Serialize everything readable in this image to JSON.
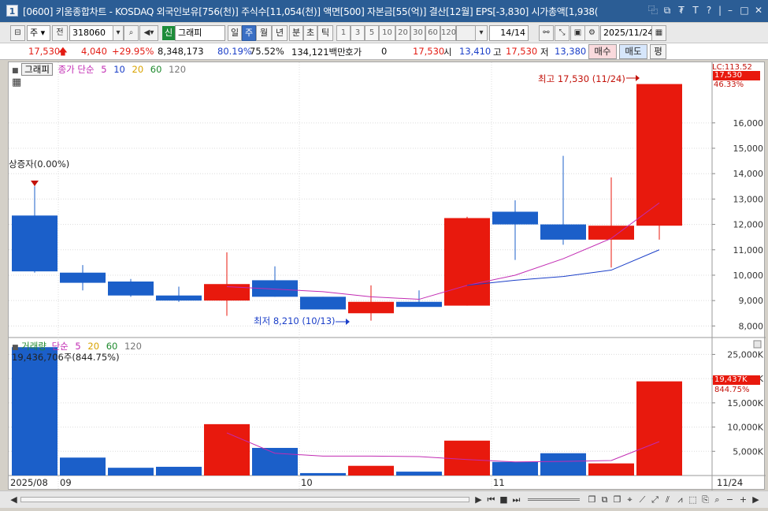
{
  "titlebar": {
    "number": "1",
    "text": "[0600] 키움종합차트 - KOSDAQ 외국인보유[756(천)] 주식수[11,054(천)] 액면[500] 자본금[55(억)] 결산[12월] EPS[-3,830] 시가총액[1,938(",
    "buttons": [
      "⿻",
      "⧉",
      "₮",
      "T",
      "?",
      "|",
      "–",
      "□",
      "✕"
    ]
  },
  "toolbar": {
    "market": "주",
    "prev": "전",
    "code": "318060",
    "sin_badge": "신",
    "stock_name": "그래피",
    "periods": [
      "일",
      "주",
      "월",
      "년",
      "분",
      "초",
      "틱"
    ],
    "active_period": "주",
    "intervals": [
      "1",
      "3",
      "5",
      "10",
      "20",
      "30",
      "60",
      "120"
    ],
    "count": "14/14",
    "date": "2025/11/24"
  },
  "quote": {
    "price": "17,530",
    "arrow": "🡅",
    "change": "4,040",
    "change_pct": "+29.95%",
    "volume": "8,348,173",
    "vol_pct": "80.19%",
    "turnover": "75.52%",
    "amount": "134,121백만",
    "hoga_label": "호가",
    "hoga_value": "0",
    "current": "17,530",
    "open_label": "시",
    "open": "13,410",
    "high_label": "고",
    "high": "17,530",
    "low_label": "저",
    "low": "13,380",
    "buy_button": "매수",
    "sell_button": "매도",
    "eval_button": "평"
  },
  "price_legend": {
    "name": "그래피",
    "label": "종가 단순",
    "periods": [
      "5",
      "10",
      "20",
      "60",
      "120"
    ],
    "colors": [
      "#c22bb3",
      "#1a3ec8",
      "#d9a300",
      "#1f8a2e",
      "#777777"
    ]
  },
  "volume_legend": {
    "name": "거래량",
    "label": "단순",
    "periods": [
      "5",
      "20",
      "60",
      "120"
    ],
    "colors": [
      "#c22bb3",
      "#d9a300",
      "#1f8a2e",
      "#777777"
    ],
    "current_text": "19,436,706주(844.75%)"
  },
  "annotations": {
    "ipo": "상증자(0.00%)",
    "high": "최고 17,530 (11/24)",
    "low": "최저 8,210 (10/13)"
  },
  "price_axis": {
    "ticks": [
      "16,000",
      "15,000",
      "14,000",
      "13,000",
      "12,000",
      "11,000",
      "10,000",
      "9,000",
      "8,000"
    ],
    "tag_top": "LC:113.52",
    "tag_price": "17,530",
    "tag_pct": "46.33%"
  },
  "volume_axis": {
    "ticks": [
      "25,000K",
      "20,000K",
      "15,000K",
      "10,000K",
      "5,000K"
    ],
    "tag_value": "19,437K",
    "tag_pct": "844.75%"
  },
  "x_axis": {
    "labels": [
      "2025/08",
      "09",
      "10",
      "11"
    ],
    "end_label": "11/24"
  },
  "colors": {
    "up": "#e8190d",
    "down": "#1b5fc9",
    "ma5": "#c22bb3",
    "ma10": "#1a3ec8"
  },
  "chart_data": {
    "type": "candlestick",
    "price": {
      "ylim": [
        7700,
        18200
      ],
      "candles": [
        {
          "open": 12350,
          "high": 13500,
          "low": 10100,
          "close": 10150
        },
        {
          "open": 10100,
          "high": 10400,
          "low": 9400,
          "close": 9700
        },
        {
          "open": 9750,
          "high": 9850,
          "low": 9150,
          "close": 9200
        },
        {
          "open": 9200,
          "high": 9550,
          "low": 8950,
          "close": 9000
        },
        {
          "open": 9000,
          "high": 10900,
          "low": 8400,
          "close": 9650
        },
        {
          "open": 9800,
          "high": 10350,
          "low": 9150,
          "close": 9150
        },
        {
          "open": 9150,
          "high": 9150,
          "low": 8650,
          "close": 8650
        },
        {
          "open": 8500,
          "high": 9600,
          "low": 8210,
          "close": 8950
        },
        {
          "open": 8950,
          "high": 9400,
          "low": 8800,
          "close": 8750
        },
        {
          "open": 8800,
          "high": 12300,
          "low": 8800,
          "close": 12250
        },
        {
          "open": 12500,
          "high": 12950,
          "low": 10600,
          "close": 12000
        },
        {
          "open": 12000,
          "high": 14700,
          "low": 11200,
          "close": 11400
        },
        {
          "open": 11400,
          "high": 13850,
          "low": 10300,
          "close": 11950
        },
        {
          "open": 11950,
          "high": 17530,
          "low": 11400,
          "close": 17530
        }
      ],
      "ma5": [
        null,
        null,
        null,
        null,
        9550,
        9450,
        9350,
        9150,
        9050,
        9600,
        10000,
        10650,
        11450,
        12850
      ],
      "ma10": [
        null,
        null,
        null,
        null,
        null,
        null,
        null,
        null,
        null,
        9600,
        9800,
        9950,
        10200,
        11000
      ]
    },
    "volume": {
      "ylim": [
        0,
        28000
      ],
      "values": [
        26500,
        3700,
        1600,
        1800,
        10600,
        5700,
        500,
        2000,
        800,
        7200,
        2800,
        4600,
        2500,
        19437
      ],
      "ma5": [
        null,
        null,
        null,
        null,
        8800,
        4600,
        4000,
        4000,
        3900,
        3300,
        2800,
        2900,
        3100,
        7000
      ]
    }
  }
}
